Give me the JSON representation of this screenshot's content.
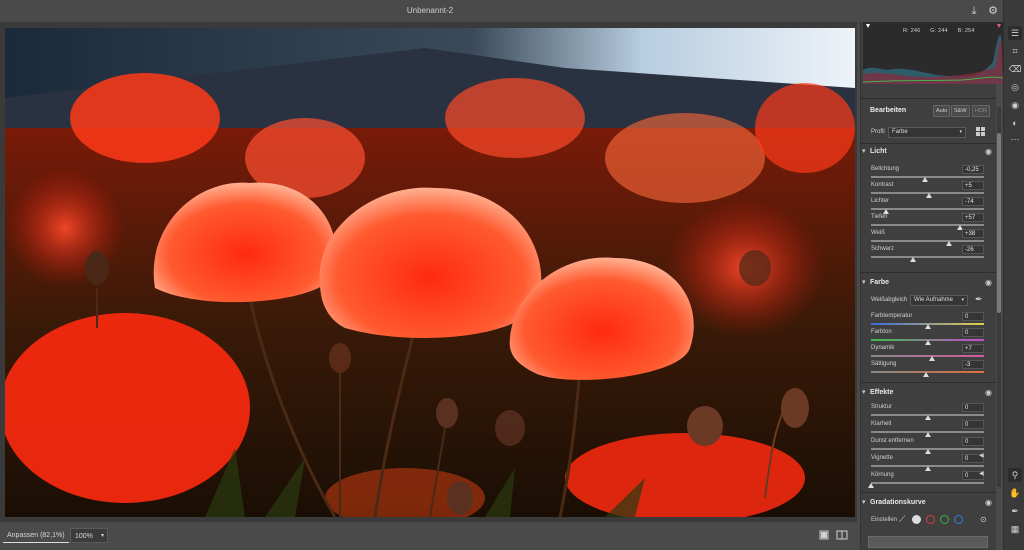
{
  "window": {
    "title": "Unbenannt-2"
  },
  "statusbar": {
    "fit_label": "Anpassen (82,1%)",
    "zoom_value": "100%"
  },
  "histogram": {
    "r": "R: 246",
    "g": "G: 244",
    "b": "B: 254"
  },
  "edit": {
    "title": "Bearbeiten",
    "auto_label": "Auto",
    "bw_label": "S&W",
    "hdr_label": "HDR",
    "profile_label": "Profil",
    "profile_value": "Farbe"
  },
  "light": {
    "title": "Licht",
    "sliders": [
      {
        "label": "Belichtung",
        "value": "-0,25",
        "position": 0.48
      },
      {
        "label": "Kontrast",
        "value": "+5",
        "position": 0.51
      },
      {
        "label": "Lichter",
        "value": "-74",
        "position": 0.13
      },
      {
        "label": "Tiefen",
        "value": "+57",
        "position": 0.79
      },
      {
        "label": "Weiß",
        "value": "+38",
        "position": 0.69
      },
      {
        "label": "Schwarz",
        "value": "-26",
        "position": 0.37
      }
    ]
  },
  "color": {
    "title": "Farbe",
    "wb_label": "Weißabgleich",
    "wb_value": "Wie Aufnahme",
    "sliders": [
      {
        "label": "Farbtemperatur",
        "value": "0",
        "position": 0.5
      },
      {
        "label": "Farbton",
        "value": "0",
        "position": 0.5
      },
      {
        "label": "Dynamik",
        "value": "+7",
        "position": 0.54
      },
      {
        "label": "Sättigung",
        "value": "-3",
        "position": 0.49
      }
    ]
  },
  "effects": {
    "title": "Effekte",
    "sliders": [
      {
        "label": "Struktur",
        "value": "0",
        "position": 0.5
      },
      {
        "label": "Klarheit",
        "value": "0",
        "position": 0.5
      },
      {
        "label": "Dunst entfernen",
        "value": "0",
        "position": 0.5
      },
      {
        "label": "Vignette",
        "value": "0",
        "position": 0.5
      },
      {
        "label": "Körnung",
        "value": "0",
        "position": 0.0
      }
    ]
  },
  "curve": {
    "title": "Gradationskurve",
    "adjust_label": "Einstellen"
  },
  "colors": {
    "accent_blue": "#3a6bd6",
    "accent_red": "#e0301a",
    "panel": "#3f3f3f"
  }
}
